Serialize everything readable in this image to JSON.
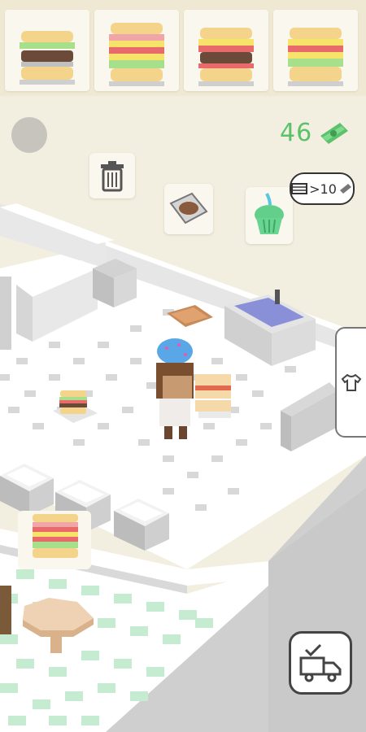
{
  "hud": {
    "money": "46",
    "ad_reward_label": ">10",
    "colors": {
      "money": "#59c26b",
      "floor_tile_dark": "#d7d7d7",
      "floor_dining_green": "#bfe9c8",
      "wall": "#e6e6e6"
    }
  },
  "orders": [
    {
      "name": "sandwich-order-1",
      "layers": [
        "bread",
        "lettuce",
        "patty",
        "bread"
      ]
    },
    {
      "name": "sandwich-order-2",
      "layers": [
        "bread",
        "ham",
        "cheese",
        "tomato",
        "lettuce",
        "bread"
      ]
    },
    {
      "name": "sandwich-order-3",
      "layers": [
        "bread",
        "cheese",
        "tomato",
        "patty",
        "bread"
      ]
    },
    {
      "name": "sandwich-order-4",
      "layers": [
        "bread",
        "cheese",
        "tomato",
        "lettuce",
        "bread"
      ]
    }
  ],
  "icons": {
    "trash": "trash-can-icon",
    "chocolate": "chocolate-spread-icon",
    "cupcake": "cupcake-icon",
    "outfit": "t-shirt-icon",
    "delivery": "delivery-truck-icon",
    "ad": "video-ad-icon",
    "cash": "cash-icon"
  }
}
